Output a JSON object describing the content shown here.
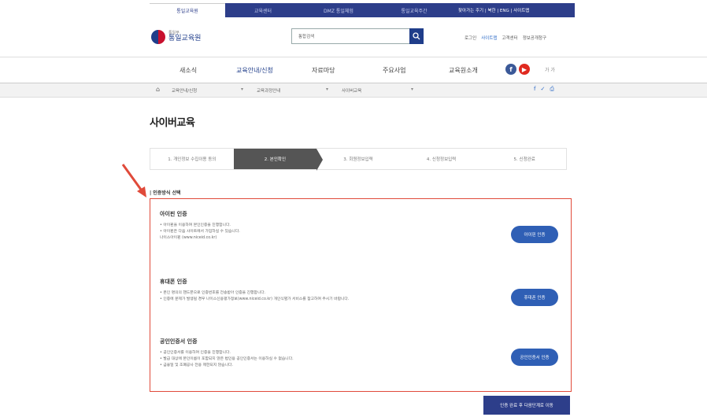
{
  "topbar": {
    "tabs": [
      "통일교육원",
      "교육센터",
      "DMZ 통일체험",
      "통일교육주간"
    ],
    "links": "찾아가는 주기 | 북한 | ENG | 사이트맵"
  },
  "header": {
    "logo_sub": "통일부",
    "logo_name": "통일교육원",
    "search_category": "통합검색",
    "search_placeholder": "",
    "util_links": [
      "로그인",
      "사이트맵",
      "고객센터",
      "정보공개청구"
    ]
  },
  "gnb": {
    "items": [
      "새소식",
      "교육안내/신청",
      "자료마당",
      "주요사업",
      "교육원소개"
    ],
    "tools": "가 가"
  },
  "location": {
    "home_icon": "home-icon",
    "segments": [
      "교육안내/신청",
      "교육과정안내",
      "사이버교육"
    ]
  },
  "page": {
    "title": "사이버교육"
  },
  "steps": [
    "1. 개인정보 수집이용 동의",
    "2. 본인확인",
    "3. 회원정보입력",
    "4. 신청정보입력",
    "5. 신청완료"
  ],
  "section_label": "| 인증방식 선택",
  "methods": [
    {
      "title": "아이핀 인증",
      "lines": [
        "• 아이핀을 이용하여 본인인증을 진행합니다.",
        "• 아이핀은 다음 사이트에서 가입하실 수 있습니다.",
        "   나이스아이핀 (www.niceid.co.kr)"
      ],
      "button": "아이핀 인증"
    },
    {
      "title": "휴대폰 인증",
      "lines": [
        "• 본인 명의의 핸드폰으로 인증번호를 전송받아 인증을 진행합니다.",
        "• 인증에 문제가 발생될 경우 나이스신용평가정보(www.niceid.co.kr) 개인식별가 서비스를 참고하여 주시기 바랍니다."
      ],
      "button": "휴대폰 인증"
    },
    {
      "title": "공인인증서 인증",
      "lines": [
        "• 공인인증서를 이용하여 인증을 진행합니다.",
        "• 발급 대상에 본인이름이 포함되지 않은 법인용 공인인증서는 이용하실 수 없습니다.",
        "• 금융일 및 조폐공사 전용 제한되지 않습니다."
      ],
      "button": "공인인증서 인증"
    }
  ],
  "next_button": "인증 완료 후 다음단계로 이동",
  "colors": {
    "brand": "#2d3e8a",
    "button": "#2f5fb5",
    "highlight": "#e04a3a"
  }
}
